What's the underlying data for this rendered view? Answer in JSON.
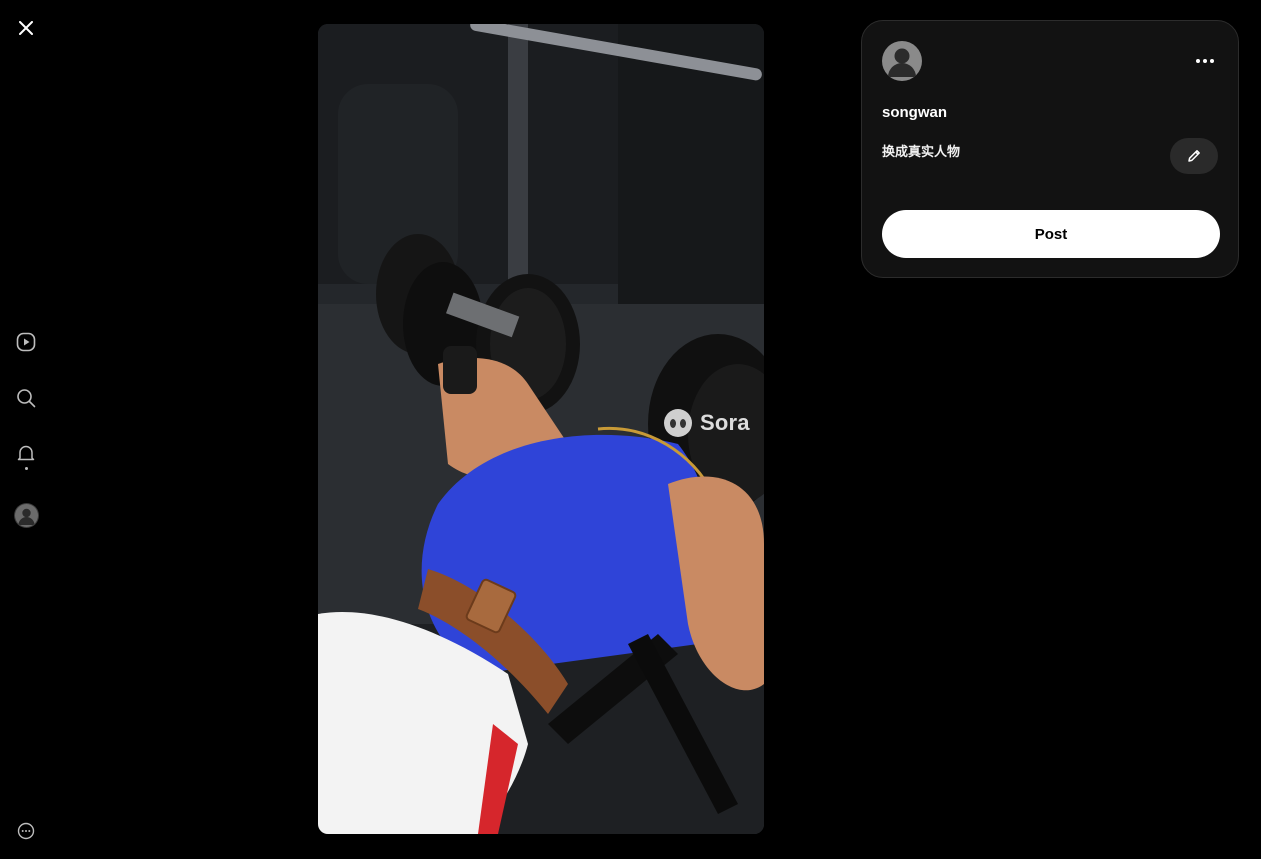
{
  "nav": {
    "close_icon": "close-icon",
    "items": [
      {
        "icon": "play-icon"
      },
      {
        "icon": "search-icon"
      },
      {
        "icon": "bell-icon"
      },
      {
        "icon": "avatar"
      }
    ],
    "more_icon": "more-circle-icon"
  },
  "video": {
    "watermark": "Sora"
  },
  "post": {
    "username": "songwan",
    "caption": "换成真实人物",
    "post_label": "Post",
    "edit_icon": "pencil-icon",
    "more_icon": "ellipsis-icon"
  },
  "colors": {
    "background": "#000000",
    "card": "#121212",
    "post_button": "#ffffff",
    "shirt": "#2f44d8"
  }
}
